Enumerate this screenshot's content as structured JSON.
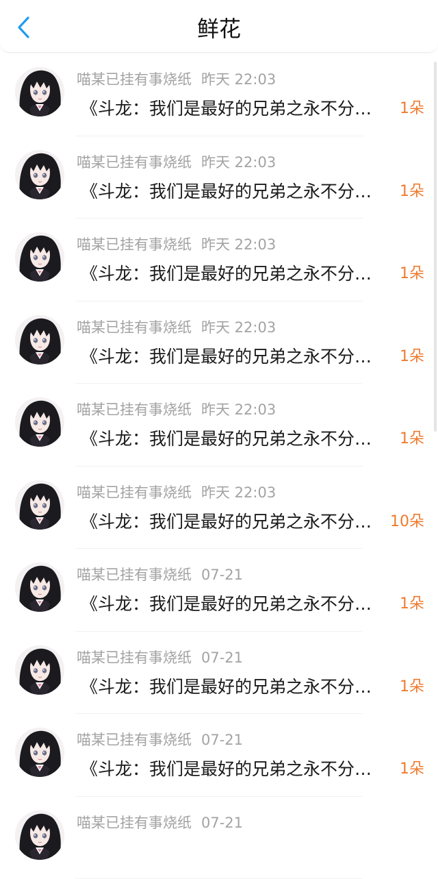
{
  "header": {
    "title": "鲜花",
    "back_icon": "chevron-left-icon",
    "accent_color": "#1f9cf0"
  },
  "rows": [
    {
      "name": "喵某已挂有事烧纸",
      "time": "昨天 22:03",
      "message": "《斗龙：我们是最好的兄弟之永不分离》",
      "flowers": "1朵"
    },
    {
      "name": "喵某已挂有事烧纸",
      "time": "昨天 22:03",
      "message": "《斗龙：我们是最好的兄弟之永不分离》",
      "flowers": "1朵"
    },
    {
      "name": "喵某已挂有事烧纸",
      "time": "昨天 22:03",
      "message": "《斗龙：我们是最好的兄弟之永不分离》",
      "flowers": "1朵"
    },
    {
      "name": "喵某已挂有事烧纸",
      "time": "昨天 22:03",
      "message": "《斗龙：我们是最好的兄弟之永不分离》",
      "flowers": "1朵"
    },
    {
      "name": "喵某已挂有事烧纸",
      "time": "昨天 22:03",
      "message": "《斗龙：我们是最好的兄弟之永不分离》",
      "flowers": "1朵"
    },
    {
      "name": "喵某已挂有事烧纸",
      "time": "昨天 22:03",
      "message": "《斗龙：我们是最好的兄弟之永不分离》",
      "flowers": "10朵"
    },
    {
      "name": "喵某已挂有事烧纸",
      "time": "07-21",
      "message": "《斗龙：我们是最好的兄弟之永不分离》",
      "flowers": "1朵"
    },
    {
      "name": "喵某已挂有事烧纸",
      "time": "07-21",
      "message": "《斗龙：我们是最好的兄弟之永不分离》",
      "flowers": "1朵"
    },
    {
      "name": "喵某已挂有事烧纸",
      "time": "07-21",
      "message": "《斗龙：我们是最好的兄弟之永不分离》",
      "flowers": "1朵"
    },
    {
      "name": "喵某已挂有事烧纸",
      "time": "07-21",
      "message": "",
      "flowers": ""
    }
  ],
  "colors": {
    "name": "#a3a3a3",
    "message": "#1a1a1a",
    "flower": "#ee7b2f"
  }
}
